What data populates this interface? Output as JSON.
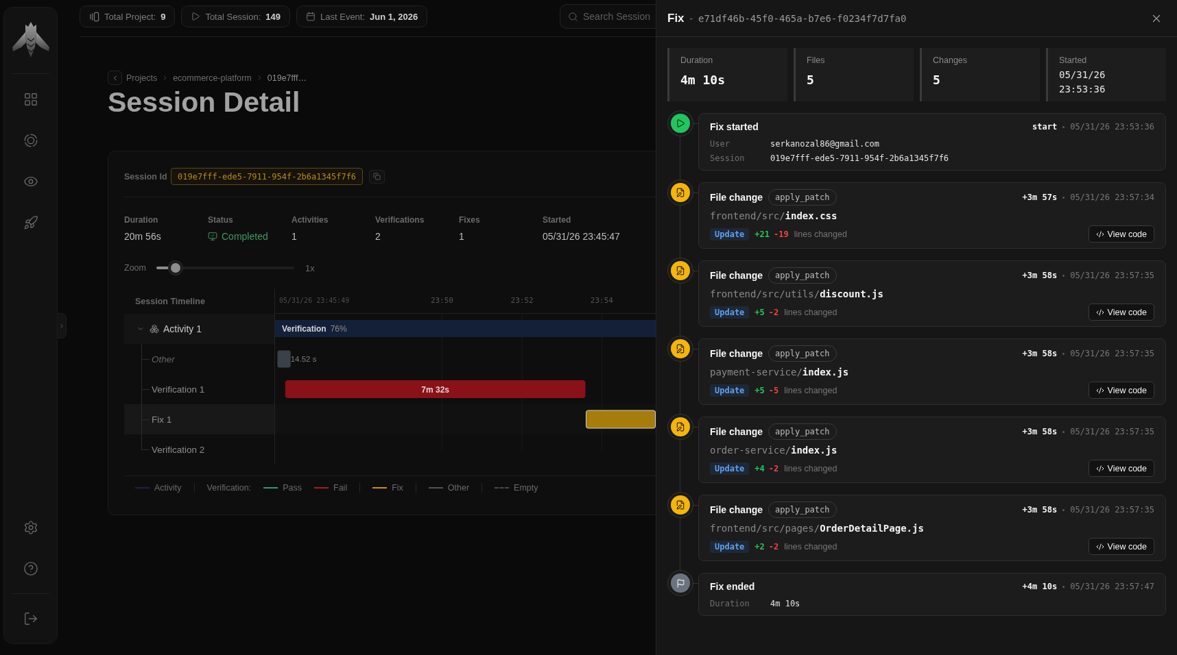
{
  "top_bar": {
    "stats": [
      {
        "kind": "projects",
        "label": "Total Project:",
        "value": "9"
      },
      {
        "kind": "sessions",
        "label": "Total Session:",
        "value": "149"
      },
      {
        "kind": "last_event",
        "label": "Last Event:",
        "value": "Jun 1, 2026"
      }
    ],
    "search": {
      "placeholder": "Search Session"
    }
  },
  "breadcrumb": [
    {
      "label": "Projects"
    },
    {
      "label": "ecommerce-platform"
    },
    {
      "label": "019e7fff…"
    }
  ],
  "page_title": "Session Detail",
  "session": {
    "id_label": "Session Id",
    "id": "019e7fff-ede5-7911-954f-2b6a1345f7f6",
    "stats": [
      {
        "kind": "text",
        "label": "Duration",
        "value": "20m 56s"
      },
      {
        "kind": "status",
        "label": "Status",
        "value": "Completed"
      },
      {
        "kind": "text",
        "label": "Activities",
        "value": "1"
      },
      {
        "kind": "text",
        "label": "Verifications",
        "value": "2"
      },
      {
        "kind": "text",
        "label": "Fixes",
        "value": "1"
      },
      {
        "kind": "text",
        "label": "Started",
        "value": "05/31/26 23:45:47"
      }
    ],
    "zoom": {
      "label": "Zoom",
      "level": 0.14,
      "reading": "1x"
    },
    "timeline": {
      "heading": "Session Timeline",
      "rows": [
        {
          "kind": "activity",
          "label": "Activity 1",
          "expanded": true,
          "bar_label": "Verification",
          "bar_value": "76%",
          "children": [
            {
              "kind": "other",
              "label": "Other",
              "selected": false,
              "bar_label": "14.52 s"
            },
            {
              "kind": "verification",
              "label": "Verification 1",
              "selected": false,
              "bar_label": "7m 32s"
            },
            {
              "kind": "fix",
              "label": "Fix 1",
              "selected": true
            },
            {
              "kind": "verification",
              "label": "Verification 2",
              "selected": false
            }
          ]
        }
      ],
      "chart_data": {
        "type": "bar",
        "orientation": "horizontal",
        "base": [
          23.7636,
          23.7646,
          23.7677,
          23.8933
        ],
        "values": [
          0.3489,
          0.0055,
          0.1256,
          0.0694
        ],
        "colors": [
          "#14203a",
          "#3c4048",
          "#8a1118",
          "#a67c0b"
        ],
        "xlim": [
          23.7636,
          23.9225
        ],
        "xticks": [
          {
            "value": 23.7636,
            "label": "05/31/26 23:45:49"
          },
          {
            "value": 23.8333,
            "label": "23:50"
          },
          {
            "value": 23.8667,
            "label": "23:52"
          },
          {
            "value": 23.9,
            "label": "23:54"
          }
        ],
        "grid": true
      }
    },
    "legend": [
      {
        "entries": [
          {
            "kind": "line",
            "label": "Activity",
            "color": "#1b2440"
          }
        ]
      },
      {
        "title": "Verification:",
        "entries": [
          {
            "kind": "line",
            "label": "Pass",
            "color": "#3b9474"
          },
          {
            "kind": "line",
            "label": "Fail",
            "color": "#a51d24"
          }
        ]
      },
      {
        "entries": [
          {
            "kind": "line",
            "label": "Fix",
            "color": "#c8950f"
          }
        ]
      },
      {
        "entries": [
          {
            "kind": "line",
            "label": "Other",
            "color": "#4f535a"
          }
        ]
      },
      {
        "entries": [
          {
            "kind": "dashed",
            "label": "Empty",
            "color": "#4a4a4a"
          }
        ]
      }
    ]
  },
  "fix_panel": {
    "title": "Fix",
    "separator": "-",
    "id": "e71df46b-45f0-465a-b7e6-f0234f7d7fa0",
    "stats": [
      {
        "kind": "value",
        "label": "Duration",
        "value": "4m 10s"
      },
      {
        "kind": "value",
        "label": "Files",
        "value": "5"
      },
      {
        "kind": "value",
        "label": "Changes",
        "value": "5"
      },
      {
        "kind": "time",
        "label": "Started",
        "value": "05/31/26 23:53:36"
      }
    ],
    "events": [
      {
        "kind": "start",
        "title": "Fix started",
        "offset": "start",
        "time": "05/31/26 23:53:36",
        "details": [
          {
            "label": "User",
            "value": "serkanozal86@gmail.com"
          },
          {
            "label": "Session",
            "value": "019e7fff-ede5-7911-954f-2b6a1345f7f6"
          }
        ]
      },
      {
        "kind": "file_change",
        "title": "File change",
        "tag": "apply_patch",
        "offset": "+3m 57s",
        "time": "05/31/26 23:57:34",
        "dir": "frontend/src/",
        "file": "index.css",
        "action": "Update",
        "added": "+21",
        "removed": "-19",
        "summary": "lines changed",
        "button": "View code"
      },
      {
        "kind": "file_change",
        "title": "File change",
        "tag": "apply_patch",
        "offset": "+3m 58s",
        "time": "05/31/26 23:57:35",
        "dir": "frontend/src/utils/",
        "file": "discount.js",
        "action": "Update",
        "added": "+5",
        "removed": "-2",
        "summary": "lines changed",
        "button": "View code"
      },
      {
        "kind": "file_change",
        "title": "File change",
        "tag": "apply_patch",
        "offset": "+3m 58s",
        "time": "05/31/26 23:57:35",
        "dir": "payment-service/",
        "file": "index.js",
        "action": "Update",
        "added": "+5",
        "removed": "-5",
        "summary": "lines changed",
        "button": "View code"
      },
      {
        "kind": "file_change",
        "title": "File change",
        "tag": "apply_patch",
        "offset": "+3m 58s",
        "time": "05/31/26 23:57:35",
        "dir": "order-service/",
        "file": "index.js",
        "action": "Update",
        "added": "+4",
        "removed": "-2",
        "summary": "lines changed",
        "button": "View code"
      },
      {
        "kind": "file_change",
        "title": "File change",
        "tag": "apply_patch",
        "offset": "+3m 58s",
        "time": "05/31/26 23:57:35",
        "dir": "frontend/src/pages/",
        "file": "OrderDetailPage.js",
        "action": "Update",
        "added": "+2",
        "removed": "-2",
        "summary": "lines changed",
        "button": "View code"
      },
      {
        "kind": "end",
        "title": "Fix ended",
        "offset": "+4m 10s",
        "time": "05/31/26 23:57:47",
        "details": [
          {
            "label": "Duration",
            "value": "4m 10s"
          }
        ]
      }
    ]
  }
}
